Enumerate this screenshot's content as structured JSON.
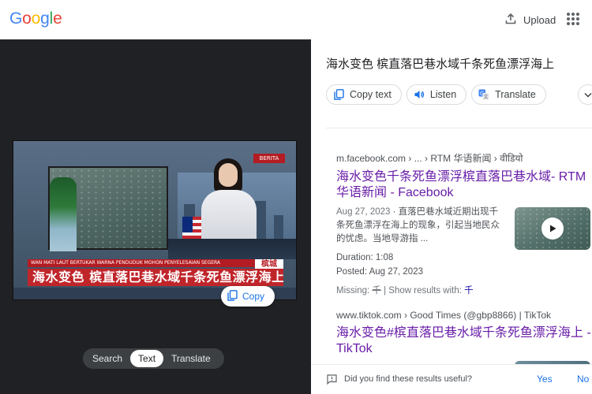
{
  "header": {
    "logo_letters": [
      {
        "ch": "G",
        "color": "#4285F4"
      },
      {
        "ch": "o",
        "color": "#EA4335"
      },
      {
        "ch": "o",
        "color": "#FBBC05"
      },
      {
        "ch": "g",
        "color": "#4285F4"
      },
      {
        "ch": "l",
        "color": "#34A853"
      },
      {
        "ch": "e",
        "color": "#EA4335"
      }
    ],
    "upload_label": "Upload",
    "upload_icon": "upload-icon",
    "apps_icon": "apps-grid-icon"
  },
  "preview": {
    "image_overlay": {
      "channel_badge": "BERITA",
      "ticker_top": "WAN MATI LAUT BERTUKAR WARNA PENDUDUK MOHON PENYELESAIAN SEGERA",
      "ticker_city": "槟城",
      "headline": "海水变色 槟直落巴巷水域千条死鱼漂浮海上"
    },
    "copy_label": "Copy",
    "modes": [
      {
        "label": "Search",
        "active": false
      },
      {
        "label": "Text",
        "active": true
      },
      {
        "label": "Translate",
        "active": false
      }
    ]
  },
  "side_panel": {
    "extracted_text": "海水变色 槟直落巴巷水域千条死鱼漂浮海上",
    "actions": [
      {
        "label": "Copy text",
        "icon": "copy-icon"
      },
      {
        "label": "Listen",
        "icon": "speaker-icon"
      },
      {
        "label": "Translate",
        "icon": "translate-icon"
      }
    ],
    "more_icon": "chevron-down-icon",
    "results": [
      {
        "cite": "m.facebook.com › ... › RTM 华语新闻 › वीडियो",
        "title": "海水变色千条死鱼漂浮槟直落巴巷水域- RTM 华语新闻 - Facebook",
        "date": "Aug 27, 2023",
        "snippet": "直落巴巷水域近期出现千条死鱼漂浮在海上的现象，引起当地民众的忧虑。当地导游指 ...",
        "duration_label": "Duration:",
        "duration": "1:08",
        "posted_label": "Posted:",
        "posted": "Aug 27, 2023",
        "missing_prefix": "Missing:",
        "missing_term": "千",
        "missing_mid": "| Show results with:",
        "missing_link": "千"
      },
      {
        "cite": "www.tiktok.com › Good Times (@gbp8866) | TikTok",
        "title": "海水变色#槟直落巴巷水域千条死鱼漂浮海上 - TikTok"
      }
    ],
    "feedback": {
      "question": "Did you find these results useful?",
      "yes": "Yes",
      "no": "No",
      "icon": "feedback-icon"
    }
  }
}
